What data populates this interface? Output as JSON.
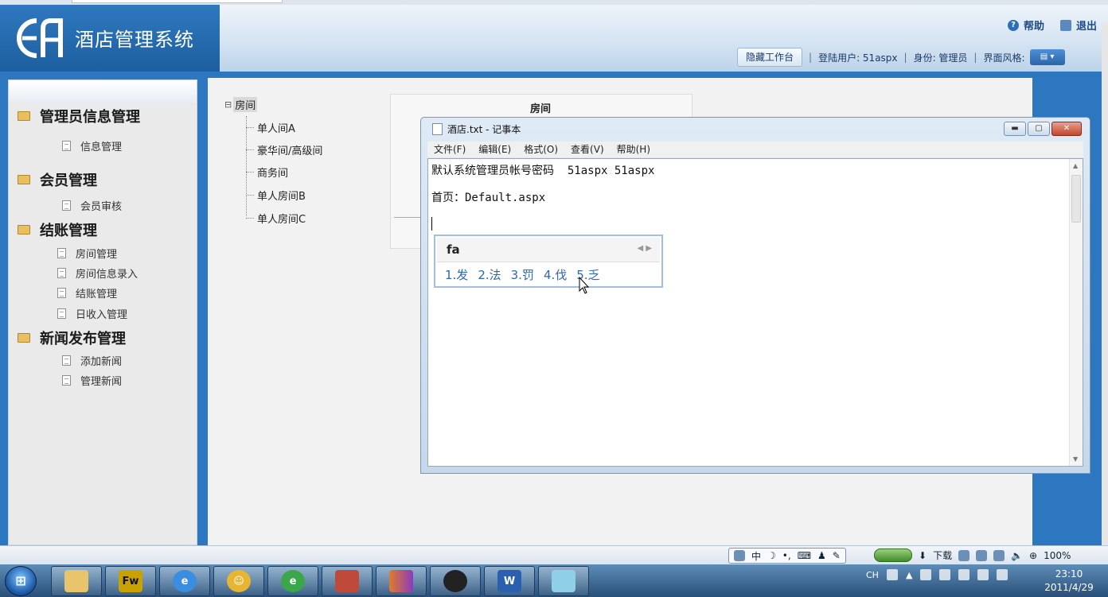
{
  "header": {
    "logo_text": "EA",
    "app_title": "酒店管理系统",
    "help_label": "帮助",
    "logout_label": "退出",
    "hide_workbench_label": "隐藏工作台",
    "login_user_label": "登陆用户: 51aspx",
    "role_label": "身份: 管理员",
    "theme_label": "界面风格:"
  },
  "sidebar": {
    "groups": [
      {
        "label": "管理员信息管理",
        "items": [
          "信息管理"
        ]
      },
      {
        "label": "会员管理",
        "items": [
          "会员审核"
        ]
      },
      {
        "label": "结账管理",
        "items": [
          "房间管理",
          "房间信息录入",
          "结账管理",
          "日收入管理"
        ]
      },
      {
        "label": "新闻发布管理",
        "items": [
          "添加新闻",
          "管理新闻"
        ]
      }
    ]
  },
  "tree": {
    "root": "房间",
    "children": [
      "单人间A",
      "豪华间/高级间",
      "商务间",
      "单人房间B",
      "单人房间C"
    ]
  },
  "panel": {
    "title": "房间"
  },
  "notepad": {
    "title": "酒店.txt - 记事本",
    "menu": [
      "文件(F)",
      "编辑(E)",
      "格式(O)",
      "查看(V)",
      "帮助(H)"
    ],
    "lines": [
      "默认系统管理员帐号密码  51aspx 51aspx",
      "首页：Default.aspx"
    ]
  },
  "ime": {
    "input": "fa",
    "candidates": [
      "1.发",
      "2.法",
      "3.罚",
      "4.伐",
      "5.乏"
    ]
  },
  "status_bar": {
    "lang_items": [
      "中"
    ],
    "download_label": "下载",
    "zoom": "100%"
  },
  "taskbar": {
    "apps": [
      "file-manager",
      "fireworks",
      "internet-explorer",
      "qq-game",
      "ie-alt",
      "toolbox",
      "media",
      "qq",
      "word",
      "notepad"
    ],
    "fw_label": "Fw",
    "word_label": "W",
    "tray_lang": "CH",
    "time": "23:10",
    "date": "2011/4/29"
  },
  "colors": {
    "header_blue": "#2c77bf",
    "sidebar_bg": "#eaeaea",
    "ime_blue": "#3167a8"
  }
}
